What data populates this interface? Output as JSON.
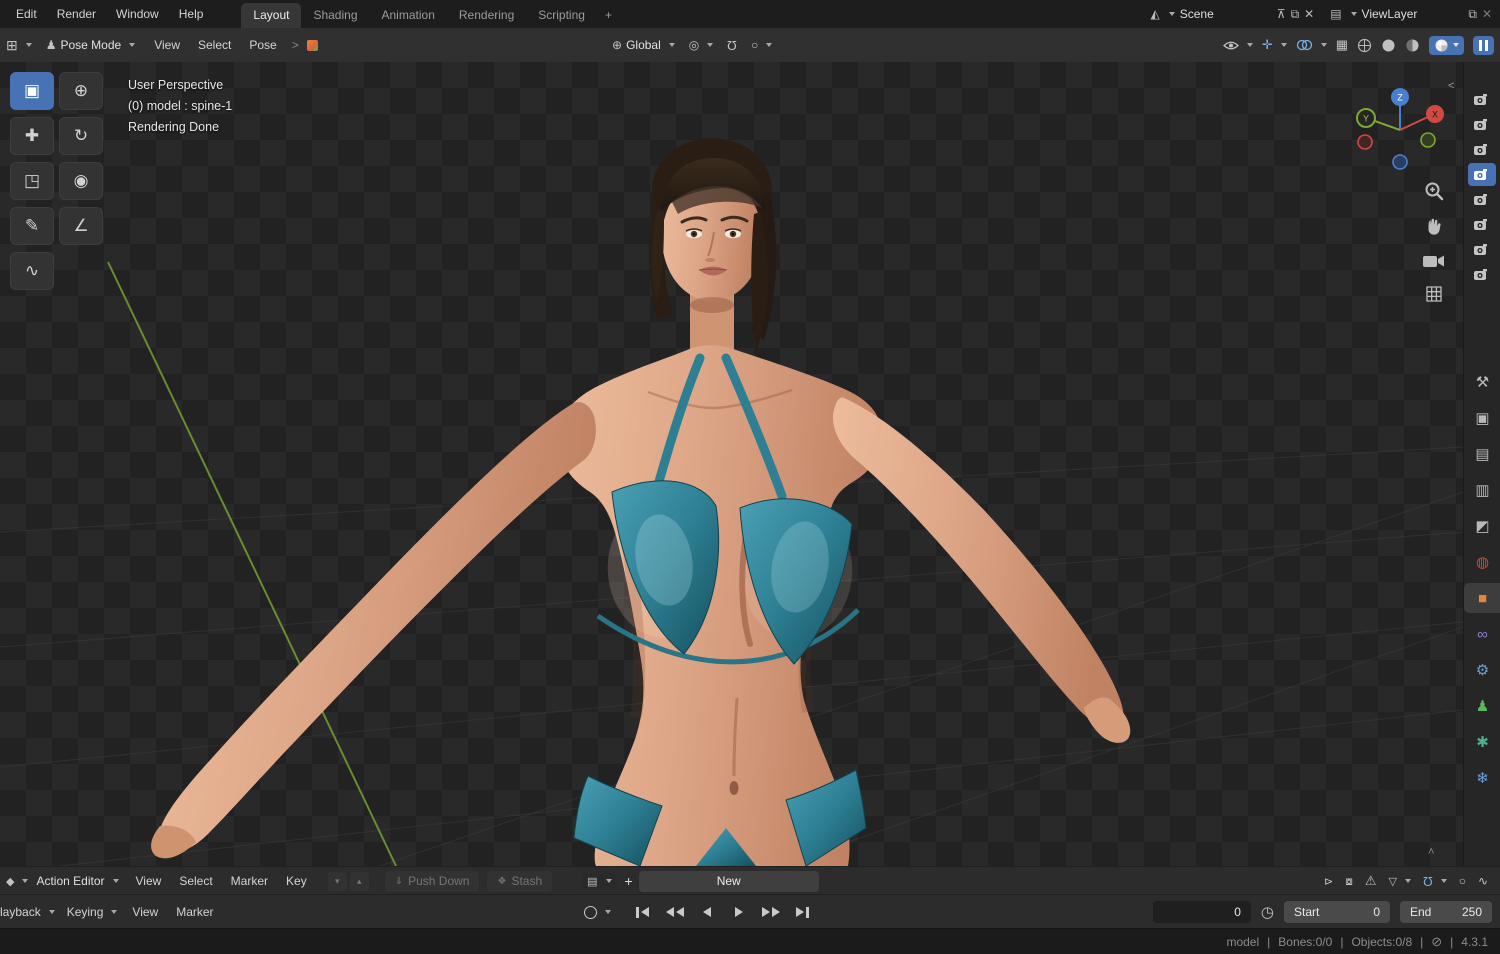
{
  "topbar": {
    "menus": [
      "Edit",
      "Render",
      "Window",
      "Help"
    ],
    "workspaces": [
      "Layout",
      "Shading",
      "Animation",
      "Rendering",
      "Scripting"
    ],
    "add_workspace": "+",
    "scene_name": "Scene",
    "viewlayer_name": "ViewLayer"
  },
  "viewport_header": {
    "mode": "Pose Mode",
    "menus": {
      "view": "View",
      "select": "Select",
      "pose": "Pose"
    },
    "orientation": "Global"
  },
  "viewport": {
    "overlay": {
      "line1": "User Perspective",
      "line2": "(0) model : spine-1",
      "line3": "Rendering Done"
    },
    "gizmo": {
      "x": "X",
      "y": "Y",
      "z": "Z"
    }
  },
  "dopesheet": {
    "editor_type": "Action Editor",
    "menus": {
      "view": "View",
      "select": "Select",
      "marker": "Marker",
      "key": "Key"
    },
    "push_down_label": "Push Down",
    "stash_label": "Stash",
    "new_label": "New"
  },
  "timeline": {
    "playback_label": "Playback",
    "keying_label": "Keying",
    "menus": {
      "view": "View",
      "marker": "Marker"
    },
    "current_frame": "0",
    "start_label": "Start",
    "start_value": "0",
    "end_label": "End",
    "end_value": "250"
  },
  "statusbar": {
    "object_name": "model",
    "bones": "Bones:0/0",
    "objects": "Objects:0/8",
    "version": "4.3.1",
    "separator": "|"
  },
  "colors": {
    "accent_blue": "#4772b3",
    "bikini_teal": "#2e7f93"
  }
}
